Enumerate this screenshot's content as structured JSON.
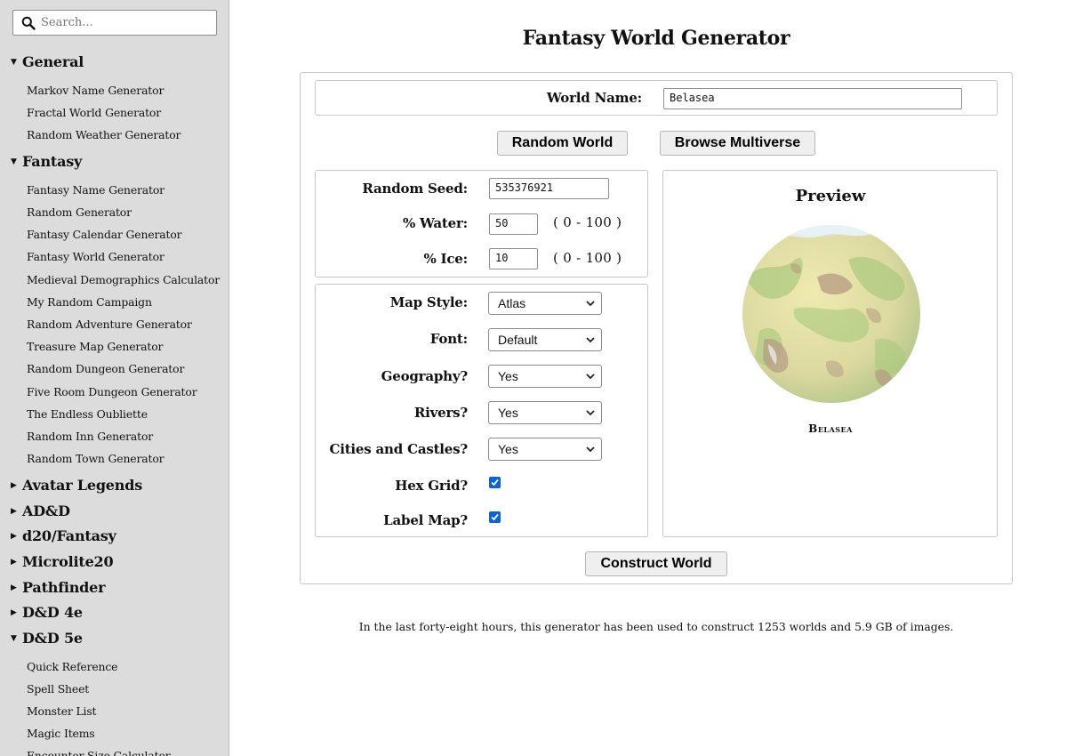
{
  "search": {
    "placeholder": "Search..."
  },
  "sidebar": {
    "sections": [
      {
        "label": "General",
        "expanded": true,
        "items": [
          "Markov Name Generator",
          "Fractal World Generator",
          "Random Weather Generator"
        ]
      },
      {
        "label": "Fantasy",
        "expanded": true,
        "items": [
          "Fantasy Name Generator",
          "Random Generator",
          "Fantasy Calendar Generator",
          "Fantasy World Generator",
          "Medieval Demographics Calculator",
          "My Random Campaign",
          "Random Adventure Generator",
          "Treasure Map Generator",
          "Random Dungeon Generator",
          "Five Room Dungeon Generator",
          "The Endless Oubliette",
          "Random Inn Generator",
          "Random Town Generator"
        ]
      },
      {
        "label": "Avatar Legends",
        "expanded": false,
        "items": []
      },
      {
        "label": "AD&D",
        "expanded": false,
        "items": []
      },
      {
        "label": "d20/Fantasy",
        "expanded": false,
        "items": []
      },
      {
        "label": "Microlite20",
        "expanded": false,
        "items": []
      },
      {
        "label": "Pathfinder",
        "expanded": false,
        "items": []
      },
      {
        "label": "D&D 4e",
        "expanded": false,
        "items": []
      },
      {
        "label": "D&D 5e",
        "expanded": true,
        "items": [
          "Quick Reference",
          "Spell Sheet",
          "Monster List",
          "Magic Items",
          "Encounter Size Calculator"
        ]
      }
    ]
  },
  "main": {
    "title": "Fantasy World Generator",
    "world_name_label": "World Name:",
    "world_name_value": "Belasea",
    "random_world_button": "Random World",
    "browse_multiverse_button": "Browse Multiverse",
    "random_seed_label": "Random Seed:",
    "random_seed_value": "535376921",
    "water_label": "% Water:",
    "water_value": "50",
    "water_range": "( 0 - 100 )",
    "ice_label": "% Ice:",
    "ice_value": "10",
    "ice_range": "( 0 - 100 )",
    "map_style_label": "Map Style:",
    "map_style_value": "Atlas",
    "font_label": "Font:",
    "font_value": "Default",
    "geography_label": "Geography?",
    "geography_value": "Yes",
    "rivers_label": "Rivers?",
    "rivers_value": "Yes",
    "cities_label": "Cities and Castles?",
    "cities_value": "Yes",
    "hex_grid_label": "Hex Grid?",
    "hex_grid_checked": true,
    "label_map_label": "Label Map?",
    "label_map_checked": true,
    "preview_title": "Preview",
    "preview_world_label": "Belasea",
    "construct_world_button": "Construct World",
    "footer_text": "In the last forty-eight hours, this generator has been used to construct 1253 worlds and 5.9 GB of images."
  },
  "colors": {
    "sidebar_bg": "#dcdcdc",
    "checkbox_accent": "#0a64d8",
    "button_bg": "#efefef",
    "globe_land_light": "#e6e3a4",
    "globe_land_green": "#a7c97d",
    "globe_mountain": "#b49a82",
    "globe_ice": "#cfe6ef"
  }
}
